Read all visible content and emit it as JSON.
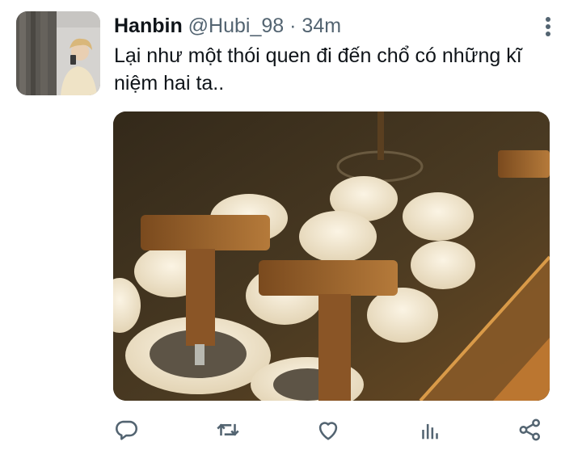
{
  "tweet": {
    "display_name": "Hanbin",
    "handle": "@Hubi_98",
    "separator": "·",
    "time": "34m",
    "text": "Lại như một thói quen đi đến chổ có những kĩ niệm hai ta.."
  },
  "icons": {
    "more": "more-vertical-icon",
    "reply": "reply-icon",
    "retweet": "retweet-icon",
    "like": "heart-icon",
    "analytics": "analytics-icon",
    "share": "share-icon"
  },
  "colors": {
    "text": "#0f1419",
    "secondary": "#536471"
  }
}
